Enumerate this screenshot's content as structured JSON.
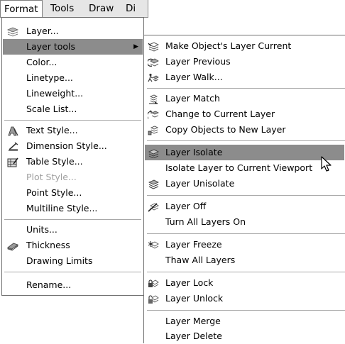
{
  "menubar": {
    "items": [
      "Format",
      "Tools",
      "Draw",
      "Di"
    ]
  },
  "format_menu": {
    "items": [
      {
        "label": "Layer...",
        "icon": "layers-icon"
      },
      {
        "label": "Layer tools",
        "icon": "",
        "submenu": true
      },
      {
        "label": "Color...",
        "icon": ""
      },
      {
        "label": "Linetype...",
        "icon": ""
      },
      {
        "label": "Lineweight...",
        "icon": ""
      },
      {
        "label": "Scale List...",
        "icon": ""
      },
      {
        "label": "Text Style...",
        "icon": "text-style-icon"
      },
      {
        "label": "Dimension Style...",
        "icon": "dimension-style-icon"
      },
      {
        "label": "Table Style...",
        "icon": "table-style-icon"
      },
      {
        "label": "Plot Style...",
        "icon": "",
        "disabled": true
      },
      {
        "label": "Point Style...",
        "icon": ""
      },
      {
        "label": "Multiline Style...",
        "icon": ""
      },
      {
        "label": "Units...",
        "icon": ""
      },
      {
        "label": "Thickness",
        "icon": "thickness-icon"
      },
      {
        "label": "Drawing Limits",
        "icon": ""
      },
      {
        "label": "Rename...",
        "icon": ""
      }
    ],
    "highlighted": "Layer tools"
  },
  "layer_tools_submenu": {
    "items": [
      {
        "label": "Make Object's Layer Current",
        "icon": "make-layer-current-icon"
      },
      {
        "label": "Layer Previous",
        "icon": "layer-previous-icon"
      },
      {
        "label": "Layer Walk...",
        "icon": "layer-walk-icon"
      },
      {
        "label": "Layer Match",
        "icon": "layer-match-icon"
      },
      {
        "label": "Change to Current Layer",
        "icon": "change-to-current-layer-icon"
      },
      {
        "label": "Copy Objects to New Layer",
        "icon": "copy-objects-new-layer-icon"
      },
      {
        "label": "Layer Isolate",
        "icon": "layer-isolate-icon"
      },
      {
        "label": "Isolate Layer to Current Viewport",
        "icon": ""
      },
      {
        "label": "Layer Unisolate",
        "icon": "layer-unisolate-icon"
      },
      {
        "label": "Layer Off",
        "icon": "layer-off-icon"
      },
      {
        "label": "Turn All Layers On",
        "icon": ""
      },
      {
        "label": "Layer Freeze",
        "icon": "layer-freeze-icon"
      },
      {
        "label": "Thaw All Layers",
        "icon": ""
      },
      {
        "label": "Layer Lock",
        "icon": "layer-lock-icon"
      },
      {
        "label": "Layer Unlock",
        "icon": "layer-unlock-icon"
      },
      {
        "label": "Layer Merge",
        "icon": ""
      },
      {
        "label": "Layer Delete",
        "icon": ""
      }
    ],
    "highlighted": "Layer Isolate"
  },
  "colors": {
    "highlight": "#8c8c8c",
    "menubar_bg": "#e6e6e6",
    "disabled_text": "#a0a0a0"
  }
}
